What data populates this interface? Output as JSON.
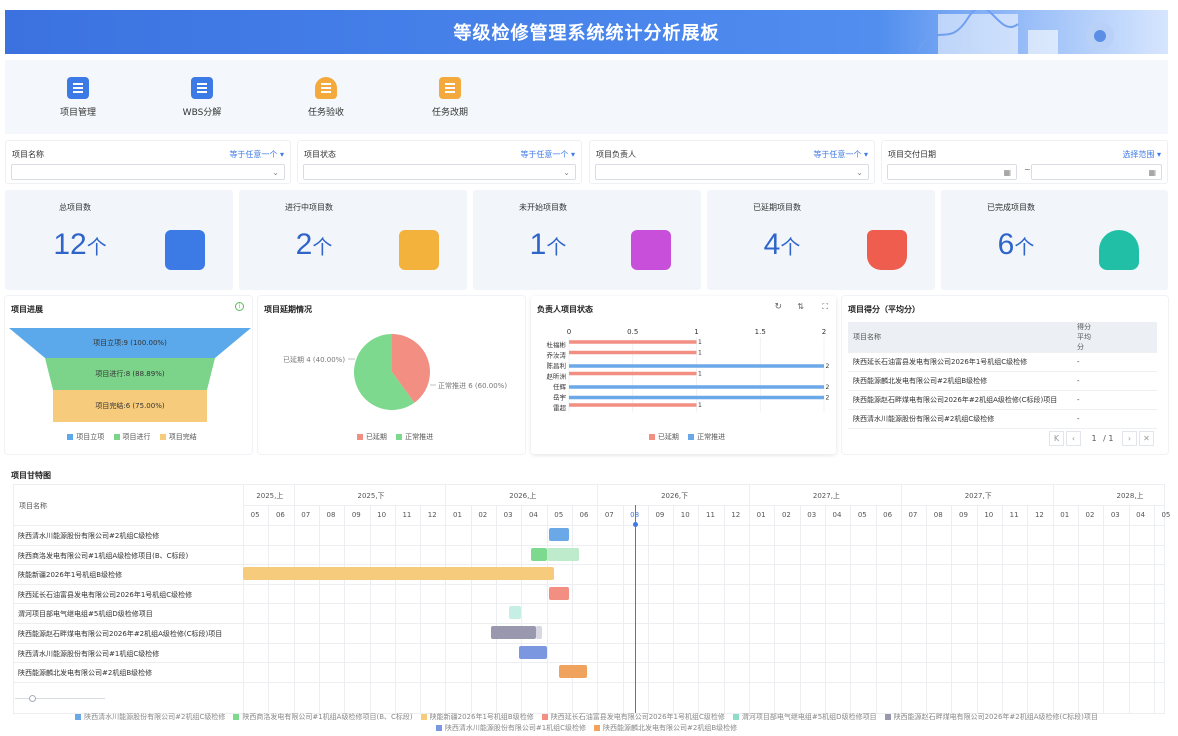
{
  "header": {
    "title": "等级检修管理系统统计分析展板"
  },
  "nav": {
    "items": [
      {
        "label": "项目管理",
        "icon": "document-icon",
        "color": "#3c7ae6"
      },
      {
        "label": "WBS分解",
        "icon": "wbs-icon",
        "color": "#3c7ae6"
      },
      {
        "label": "任务验收",
        "icon": "user-check-icon",
        "color": "#f3a93b"
      },
      {
        "label": "任务改期",
        "icon": "calendar-edit-icon",
        "color": "#f3a93b"
      }
    ]
  },
  "filters": [
    {
      "label": "项目名称",
      "op": "等于任意一个 ▾"
    },
    {
      "label": "项目状态",
      "op": "等于任意一个 ▾"
    },
    {
      "label": "项目负责人",
      "op": "等于任意一个 ▾"
    },
    {
      "label": "项目交付日期",
      "op": "选择范围 ▾",
      "sep": "~"
    }
  ],
  "stats": [
    {
      "label": "总项目数",
      "value": "12",
      "unit": "个",
      "color": "#3c7ae6"
    },
    {
      "label": "进行中项目数",
      "value": "2",
      "unit": "个",
      "color": "#f3b23b"
    },
    {
      "label": "未开始项目数",
      "value": "1",
      "unit": "个",
      "color": "#c74fd9"
    },
    {
      "label": "已延期项目数",
      "value": "4",
      "unit": "个",
      "color": "#ee5d4d"
    },
    {
      "label": "已完成项目数",
      "value": "6",
      "unit": "个",
      "color": "#21c0a6"
    }
  ],
  "progress": {
    "title": "项目进展",
    "stages": [
      {
        "label": "项目立项:9 (100.00%)",
        "color": "#5ba8ea"
      },
      {
        "label": "项目进行:8 (88.89%)",
        "color": "#7bd48a"
      },
      {
        "label": "项目完结:6 (75.00%)",
        "color": "#f7cb7c"
      }
    ],
    "legend": [
      "项目立项",
      "项目进行",
      "项目完结"
    ]
  },
  "delay": {
    "title": "项目延期情况",
    "slices": [
      {
        "label": "已延期 4 (40.00%)",
        "value": 4,
        "color": "#f28e82"
      },
      {
        "label": "正常推进 6 (60.00%)",
        "value": 6,
        "color": "#7cd98e"
      }
    ],
    "legend": [
      "已延期",
      "正常推进"
    ]
  },
  "owner": {
    "title": "负责人项目状态",
    "ticks": [
      "0",
      "0.5",
      "1",
      "1.5",
      "2"
    ],
    "people": [
      "杜福彬",
      "乔汝涛",
      "陈昌利",
      "赵昕洲",
      "任辉",
      "岳宇",
      "雷超"
    ],
    "bars": [
      {
        "name": "杜福彬",
        "delayed": 1,
        "normal": 0
      },
      {
        "name": "乔汝涛",
        "delayed": 1,
        "normal": 0
      },
      {
        "name": "陈昌利",
        "delayed": 0,
        "normal": 2
      },
      {
        "name": "赵昕洲",
        "delayed": 1,
        "normal": 0
      },
      {
        "name": "任辉",
        "delayed": 0,
        "normal": 2
      },
      {
        "name": "岳宇",
        "delayed": 0,
        "normal": 2
      },
      {
        "name": "雷超",
        "delayed": 1,
        "normal": 0
      }
    ],
    "colors": {
      "delayed": "#f28e82",
      "normal": "#6aa8e8"
    },
    "legend": [
      "已延期",
      "正常推进"
    ]
  },
  "score": {
    "title": "项目得分（平均分）",
    "headers": [
      "项目名称",
      "得分平均分"
    ],
    "rows": [
      [
        "陕西延长石油富县发电有限公司2026年1号机组C级检修",
        "-"
      ],
      [
        "陕西能源麟北发电有限公司#2机组B级检修",
        "-"
      ],
      [
        "陕西能源赵石畔煤电有限公司2026年#2机组A级检修(C标段)项目",
        "-"
      ],
      [
        "陕西清水川能源股份有限公司#2机组C级检修",
        "-"
      ]
    ],
    "page": "1",
    "pages": "/ 1"
  },
  "gantt": {
    "title": "项目甘特图",
    "col_header": "项目名称",
    "halves": [
      "2025,上",
      "2025,下",
      "2026,上",
      "2026,下",
      "2027,上",
      "2027,下",
      "2028,上"
    ],
    "months": [
      "05",
      "06",
      "07",
      "08",
      "09",
      "10",
      "11",
      "12",
      "01",
      "02",
      "03",
      "04",
      "05",
      "06",
      "07",
      "08",
      "09",
      "10",
      "11",
      "12",
      "01",
      "02",
      "03",
      "04",
      "05",
      "06",
      "07",
      "08",
      "09",
      "10",
      "11",
      "12",
      "01",
      "02",
      "03",
      "04",
      "05"
    ],
    "today_month": "08",
    "rows": [
      {
        "name": "陕西清水川能源股份有限公司#2机组C级检修",
        "bars": [
          {
            "start": 12.08,
            "end": 12.9,
            "color": "#6aa8e8"
          }
        ]
      },
      {
        "name": "陕西商洛发电有限公司#1机组A级检修项目(B、C标段)",
        "bars": [
          {
            "start": 11.4,
            "end": 12.0,
            "color": "#7cd98e"
          },
          {
            "start": 12.0,
            "end": 13.3,
            "color": "#bdebcb"
          }
        ]
      },
      {
        "name": "陕能新疆2026年1号机组B级检修",
        "bars": [
          {
            "start": 0.0,
            "end": 12.3,
            "color": "#f7cb7c"
          }
        ]
      },
      {
        "name": "陕西延长石油富县发电有限公司2026年1号机组C级检修",
        "bars": [
          {
            "start": 12.08,
            "end": 12.9,
            "color": "#f28e82"
          }
        ]
      },
      {
        "name": "渭河项目部电气继电组#5机组D级检修项目",
        "bars": [
          {
            "start": 10.5,
            "end": 11.0,
            "color": "#c5eee5"
          }
        ]
      },
      {
        "name": "陕西能源赵石畔煤电有限公司2026年#2机组A级检修(C标段)项目",
        "bars": [
          {
            "start": 9.8,
            "end": 11.6,
            "color": "#9a98ae"
          },
          {
            "start": 11.6,
            "end": 11.8,
            "color": "#d8d7e2"
          }
        ]
      },
      {
        "name": "陕西清水川能源股份有限公司#1机组C级检修",
        "bars": [
          {
            "start": 10.9,
            "end": 12.0,
            "color": "#7b97e0"
          }
        ]
      },
      {
        "name": "陕西能源麟北发电有限公司#2机组B级检修",
        "bars": [
          {
            "start": 12.5,
            "end": 13.6,
            "color": "#f0a35e"
          }
        ]
      }
    ],
    "legend": [
      {
        "label": "陕西清水川能源股份有限公司#2机组C级检修",
        "color": "#6aa8e8"
      },
      {
        "label": "陕西商洛发电有限公司#1机组A级检修项目(B、C标段)",
        "color": "#7cd98e"
      },
      {
        "label": "陕能新疆2026年1号机组B级检修",
        "color": "#f7cb7c"
      },
      {
        "label": "陕西延长石油富县发电有限公司2026年1号机组C级检修",
        "color": "#f28e82"
      },
      {
        "label": "渭河项目部电气继电组#5机组D级检修项目",
        "color": "#8fdcc9"
      },
      {
        "label": "陕西能源赵石畔煤电有限公司2026年#2机组A级检修(C标段)项目",
        "color": "#9a98ae"
      },
      {
        "label": "陕西清水川能源股份有限公司#1机组C级检修",
        "color": "#7b97e0"
      },
      {
        "label": "陕西能源麟北发电有限公司#2机组B级检修",
        "color": "#f0a35e"
      }
    ]
  }
}
